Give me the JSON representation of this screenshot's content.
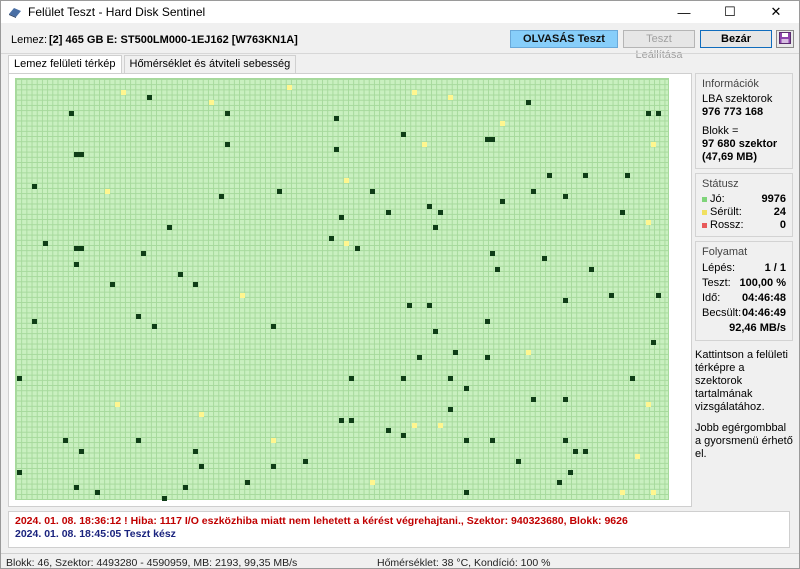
{
  "window": {
    "title": "Felület Teszt - Hard Disk Sentinel",
    "minimize_glyph": "—",
    "maximize_glyph": "☐",
    "close_glyph": "✕"
  },
  "toolbar": {
    "disk_label": "Lemez:",
    "disk_value": "[2] 465 GB E: ST500LM000-1EJ162 [W763KN1A]",
    "read_test": "OLVASÁS Teszt",
    "stop_test": "Teszt Leállítása",
    "close": "Bezár",
    "save_icon": "floppy-disk-icon"
  },
  "tabs": [
    {
      "label": "Lemez felületi térkép",
      "active": true
    },
    {
      "label": "Hőmérséklet és átviteli sebesség",
      "active": false
    }
  ],
  "colors": {
    "good": "#c9f0c0",
    "grid": "#a6d99c",
    "read_dark": "#0f3d17",
    "damaged": "#fff68f",
    "bad": "#e85a5a",
    "read_test_bg": "#87cefa",
    "error_text": "#c00000",
    "ok_text": "#1a237e"
  },
  "panel": {
    "info_title": "Információk",
    "lba_label": "LBA szektorok",
    "lba_value": "976 773 168",
    "block_label": "Blokk =",
    "block_value": "97 680 szektor",
    "block_mb": "(47,69 MB)",
    "status_title": "Státusz",
    "status": [
      {
        "label": "Jó:",
        "value": "9976"
      },
      {
        "label": "Sérült:",
        "value": "24"
      },
      {
        "label": "Rossz:",
        "value": "0"
      }
    ],
    "progress_title": "Folyamat",
    "progress": [
      {
        "label": "Lépés:",
        "value": "1 / 1"
      },
      {
        "label": "Teszt:",
        "value": "100,00 %"
      },
      {
        "label": "Idő:",
        "value": "04:46:48"
      },
      {
        "label": "Becsült:",
        "value": "04:46:49"
      }
    ],
    "speed": "92,46 MB/s",
    "hint1": "Kattintson a felületi térképre a szektorok tartalmának vizsgálatához.",
    "hint2": "Jobb egérgombbal a gyorsmenü érhető el."
  },
  "log": [
    {
      "text": "2024. 01. 08.  18:36:12 ! Hiba: 1117 I/O eszközhiba miatt nem lehetett a kérést végrehajtani., Szektor: 940323680, Blokk: 9626",
      "kind": "err"
    },
    {
      "text": "2024. 01. 08.  18:45:05   Teszt kész",
      "kind": "ok"
    }
  ],
  "statusbar": {
    "left": "Blokk: 46, Szektor: 4493280 - 4590959, MB: 2193, 99,35 MB/s",
    "middle": "Hőmérséklet: 38  °C,  Kondíció: 100 %"
  }
}
